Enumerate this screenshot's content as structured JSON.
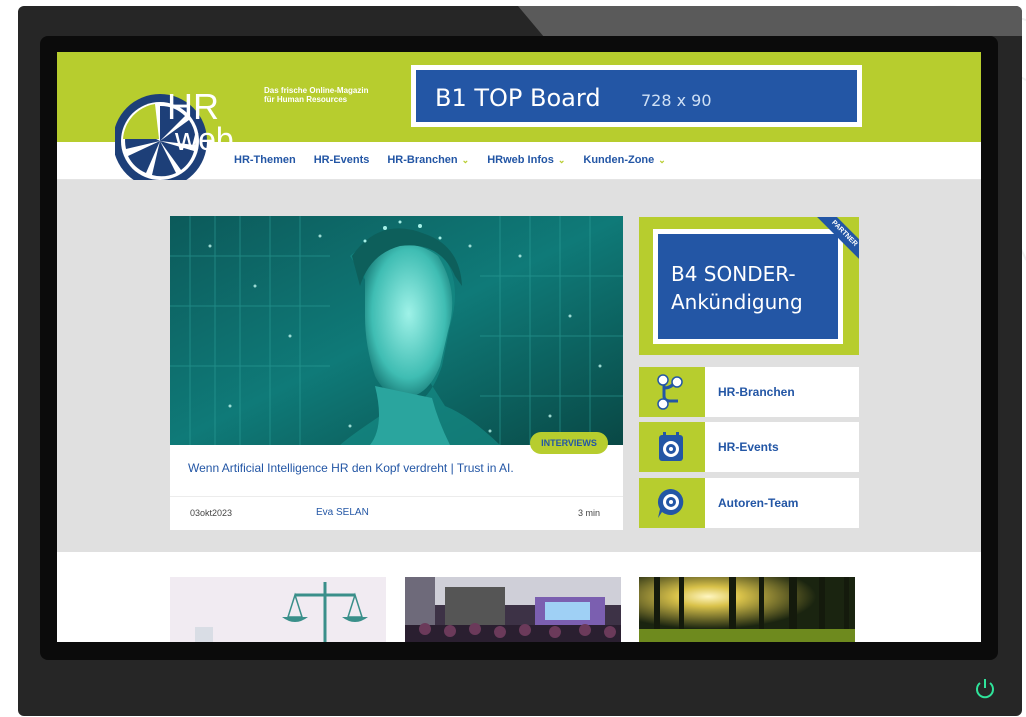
{
  "site": {
    "logo_text_top": "HR",
    "logo_text_bottom": "web",
    "tagline_line1": "Das frische Online-Magazin",
    "tagline_line2": "für Human Resources"
  },
  "top_board": {
    "title": "B1  TOP Board",
    "size": "728 x 90"
  },
  "nav": [
    {
      "label": "HR-Themen",
      "dropdown": false
    },
    {
      "label": "HR-Events",
      "dropdown": false
    },
    {
      "label": "HR-Branchen",
      "dropdown": true
    },
    {
      "label": "HRweb Infos",
      "dropdown": true
    },
    {
      "label": "Kunden-Zone",
      "dropdown": true
    }
  ],
  "article": {
    "category": "INTERVIEWS",
    "title": "Wenn Artificial Intelligence HR den Kopf verdreht | Trust in AI.",
    "date": "03okt2023",
    "author": "Eva SELAN",
    "read_time": "3 min"
  },
  "sonder": {
    "line1": "B4 SONDER-",
    "line2": "Ankündigung",
    "ribbon": "PARTNER"
  },
  "side_links": [
    {
      "label": "HR-Branchen",
      "icon": "branch-icon"
    },
    {
      "label": "HR-Events",
      "icon": "calendar-icon"
    },
    {
      "label": "Autoren-Team",
      "icon": "chat-icon"
    }
  ],
  "colors": {
    "brand_green": "#b7cd2e",
    "brand_blue": "#2356a5",
    "band_gray": "#e0e0e0"
  }
}
